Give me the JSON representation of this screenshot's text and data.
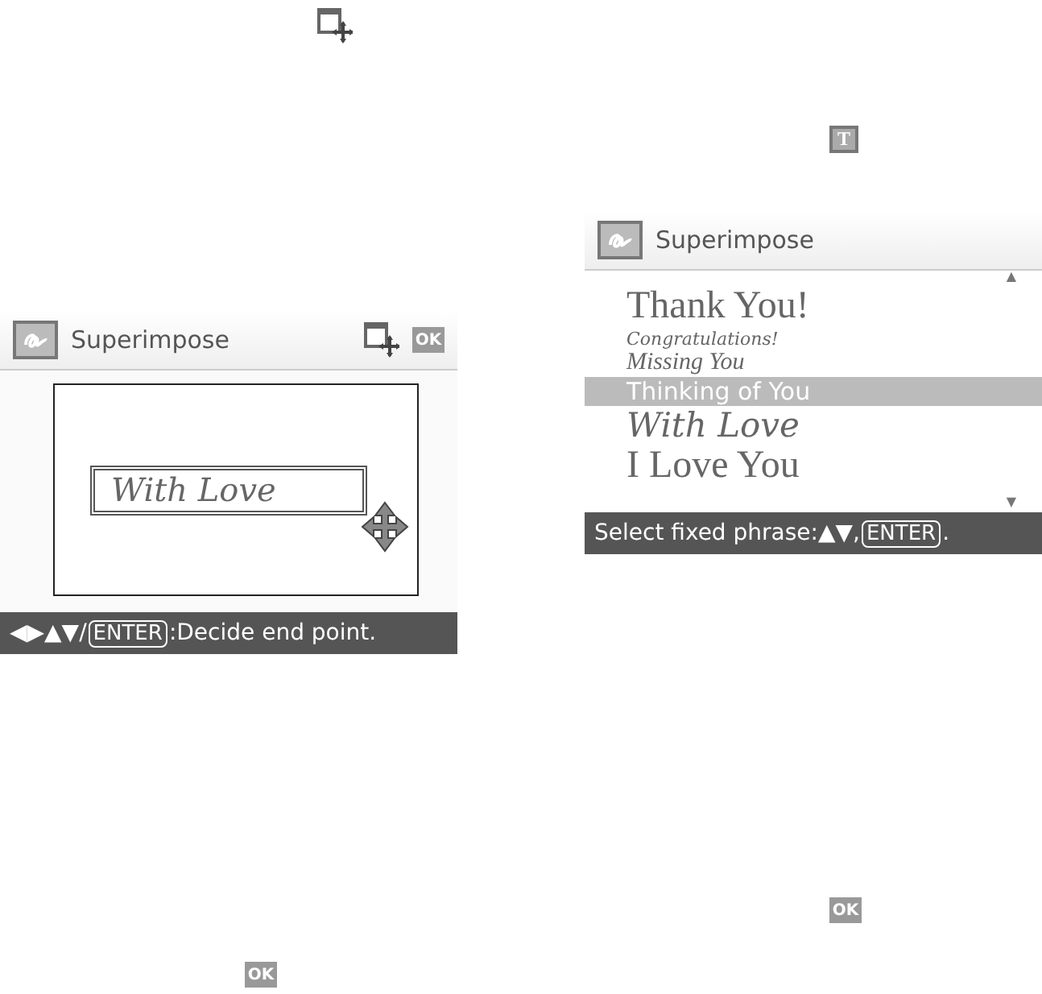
{
  "margin_icons": [
    {
      "kind": "resize"
    },
    {
      "kind": "text",
      "label": "T"
    },
    {
      "kind": "ok",
      "label": "OK"
    },
    {
      "kind": "ok",
      "label": "OK"
    }
  ],
  "screens": [
    {
      "kind": "position",
      "title": "Superimpose",
      "header_icons": [
        {
          "kind": "resize"
        },
        {
          "kind": "ok",
          "label": "OK"
        }
      ],
      "phrase": "With Love",
      "hint": [
        {
          "kind": "text",
          "text": "◀▶▲▼/"
        },
        {
          "kind": "key",
          "text": "ENTER"
        },
        {
          "kind": "text",
          "text": ":Decide end point."
        }
      ]
    },
    {
      "kind": "list",
      "title": "Superimpose",
      "scroll_up": "▲",
      "scroll_down": "▼",
      "phrases": [
        {
          "text": "Thank You!",
          "kind": "serif",
          "selected": false
        },
        {
          "text": "Congratulations!",
          "kind": "script-small",
          "selected": false
        },
        {
          "text": "Missing You",
          "kind": "script",
          "selected": false
        },
        {
          "text": "Thinking of You",
          "kind": "casual",
          "selected": true
        },
        {
          "text": "With Love",
          "kind": "hand",
          "selected": false
        },
        {
          "text": "I Love You",
          "kind": "serif",
          "selected": false
        }
      ],
      "hint": [
        {
          "kind": "text",
          "text": "Select fixed phrase:▲▼,"
        },
        {
          "kind": "key",
          "text": "ENTER"
        },
        {
          "kind": "text",
          "text": "."
        }
      ]
    }
  ]
}
